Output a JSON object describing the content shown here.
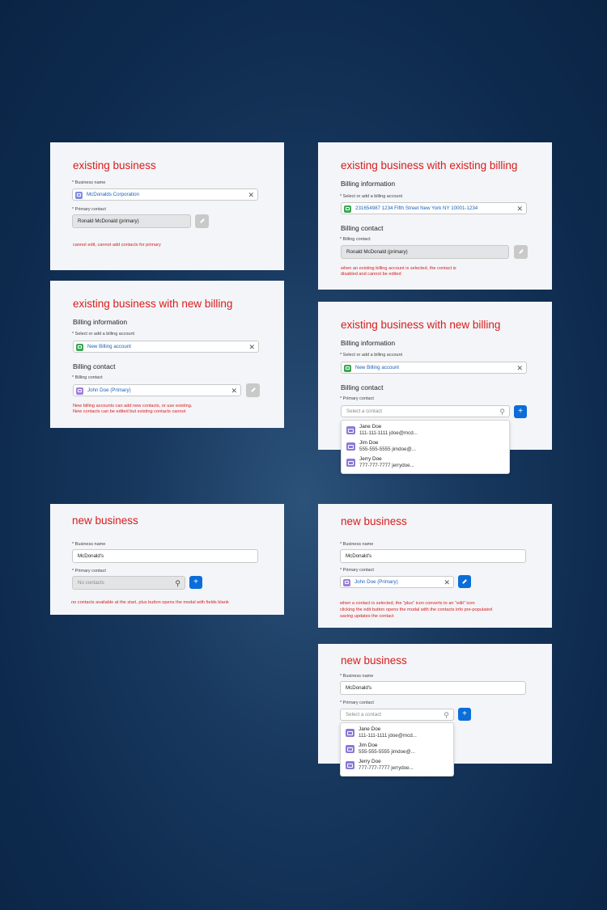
{
  "panel1": {
    "title": "existing business",
    "business_name_label": "* Business name",
    "business_name_value": "McDonalds Corporation",
    "primary_contact_label": "* Primary contact",
    "primary_contact_value": "Ronald McDonald (primary)",
    "note": "cannot edit, cannot add contacts for primary"
  },
  "panel2": {
    "title": "existing business with existing billing",
    "billing_info_heading": "Billing information",
    "billing_account_label": "* Select or add a billing account",
    "billing_account_value": "231654987 1234 Fifth Street New York NY 10001-1234",
    "billing_contact_heading": "Billing contact",
    "billing_contact_label": "* Billing contact",
    "billing_contact_value": "Ronald McDonald (primary)",
    "note_lines": [
      "when an existing billing account is selected, the contact is",
      "disabled and cannot be edited"
    ]
  },
  "panel3": {
    "title": "existing business with new billing",
    "billing_info_heading": "Billing information",
    "billing_account_label": "* Select or add a billing account",
    "billing_account_value": "New Billing account",
    "billing_contact_heading": "Billing contact",
    "billing_contact_label": "* Billing contact",
    "billing_contact_value": "John Doe (Primary)",
    "note_lines": [
      "New billing accounts can add new contacts, or use existing.",
      "New contacts can be edited but existing contacts cannot"
    ]
  },
  "panel4": {
    "title": "existing business with new billing",
    "billing_info_heading": "Billing information",
    "billing_account_label": "* Select or add a billing account",
    "billing_account_value": "New Billing account",
    "billing_contact_heading": "Billing contact",
    "primary_contact_label": "* Primary contact",
    "search_placeholder": "Select a contact",
    "contacts": [
      {
        "name": "Jane Doe",
        "detail": "111-111-1111 jdoe@mcd..."
      },
      {
        "name": "Jim Doe",
        "detail": "555-555-5555 jimdoe@..."
      },
      {
        "name": "Jerry Doe",
        "detail": "777-777-7777 jerrydoe..."
      }
    ]
  },
  "panel5": {
    "title": "new business",
    "business_name_label": "* Business name",
    "business_name_value": "McDonald's",
    "primary_contact_label": "* Primary contact",
    "search_placeholder": "No contacts",
    "note": "no contacts available at the start, plus button opens the modal with fields blank"
  },
  "panel6": {
    "title": "new business",
    "business_name_label": "* Business name",
    "business_name_value": "McDonald's",
    "primary_contact_label": "* Primary contact",
    "primary_contact_value": "John Doe (Primary)",
    "note_lines": [
      "when a contact is selected, the “plus” icon converts to an “edit” icon",
      "clicking the edit button opens the modal with the contacts info pre-populated",
      "saving updates the contact"
    ]
  },
  "panel7": {
    "title": "new business",
    "business_name_label": "* Business name",
    "business_name_value": "McDonald's",
    "primary_contact_label": "* Primary contact",
    "search_placeholder": "Select a contact",
    "contacts": [
      {
        "name": "Jane Doe",
        "detail": "111-111-1111 jdoe@mcd..."
      },
      {
        "name": "Jim Doe",
        "detail": "555-555-5555 jimdoe@..."
      },
      {
        "name": "Jerry Doe",
        "detail": "777-777-7777 jerrydoe..."
      }
    ]
  },
  "icons": {
    "clear": "✕",
    "search": "search-icon",
    "add": "+",
    "edit": "pencil-icon"
  },
  "colors": {
    "title_red": "#d81c1c",
    "link_blue": "#1b62b8",
    "button_blue": "#0b6ed8",
    "panel_bg": "#f3f5f8",
    "page_bg": "#0d2a4d"
  }
}
